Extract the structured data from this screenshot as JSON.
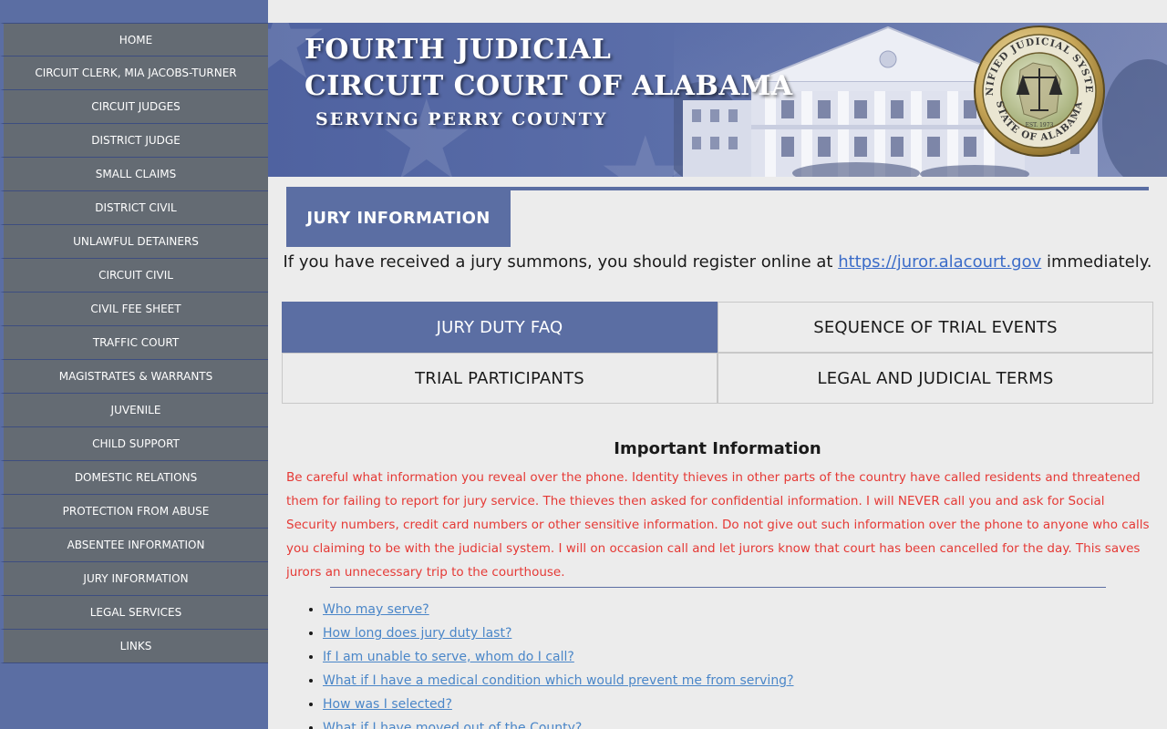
{
  "nav": [
    {
      "label": "HOME"
    },
    {
      "label": "CIRCUIT CLERK, MIA JACOBS-TURNER"
    },
    {
      "label": "CIRCUIT JUDGES"
    },
    {
      "label": "DISTRICT JUDGE"
    },
    {
      "label": "SMALL CLAIMS"
    },
    {
      "label": "DISTRICT CIVIL"
    },
    {
      "label": "UNLAWFUL DETAINERS"
    },
    {
      "label": "CIRCUIT CIVIL"
    },
    {
      "label": "CIVIL FEE SHEET"
    },
    {
      "label": "TRAFFIC COURT"
    },
    {
      "label": "MAGISTRATES & WARRANTS"
    },
    {
      "label": "JUVENILE"
    },
    {
      "label": "CHILD SUPPORT"
    },
    {
      "label": "DOMESTIC RELATIONS"
    },
    {
      "label": "PROTECTION FROM ABUSE"
    },
    {
      "label": "ABSENTEE INFORMATION"
    },
    {
      "label": "JURY INFORMATION"
    },
    {
      "label": "LEGAL SERVICES"
    },
    {
      "label": "LINKS"
    }
  ],
  "banner": {
    "line1": "FOURTH  JUDICIAL",
    "line2": "CIRCUIT COURT OF ALABAMA",
    "line3": "SERVING  PERRY  COUNTY",
    "seal": {
      "top_text": "UNIFIED JUDICIAL SYSTEM",
      "bottom_text": "STATE OF ALABAMA",
      "year": "EST. 1973"
    }
  },
  "page": {
    "title": "JURY INFORMATION",
    "summons_before": "If you have received a jury summons, you should register online at ",
    "summons_link": "https://juror.alacourt.gov",
    "summons_after": " immediately."
  },
  "tabs": [
    {
      "label": "JURY DUTY FAQ",
      "active": true
    },
    {
      "label": "SEQUENCE OF TRIAL EVENTS",
      "active": false
    },
    {
      "label": "TRIAL PARTICIPANTS",
      "active": false
    },
    {
      "label": "LEGAL AND JUDICIAL TERMS",
      "active": false
    }
  ],
  "important": {
    "heading": "Important Information",
    "text": "Be careful what information you reveal over the phone. Identity thieves in other parts of the country have called residents and threatened them for failing to report for jury service. The thieves then asked for confidential information. I will NEVER call you and ask for Social Security numbers, credit card numbers or other sensitive information. Do not give out such information over the phone to anyone who calls you claiming to be with the judicial system. I will on occasion call and let jurors know that court has been cancelled for the day. This saves jurors an unnecessary trip to the courthouse."
  },
  "faq": [
    {
      "label": "Who may serve?"
    },
    {
      "label": "How long does jury duty last?"
    },
    {
      "label": "If I am unable to serve, whom do I call?"
    },
    {
      "label": "What if I have a medical condition which would prevent me from serving?"
    },
    {
      "label": "How was I selected?"
    },
    {
      "label": "What if I have moved out of the County?"
    }
  ],
  "colors": {
    "accent": "#5b6ea3",
    "nav_bg": "#646b73",
    "warning": "#e53935",
    "link": "#4a86c8"
  }
}
